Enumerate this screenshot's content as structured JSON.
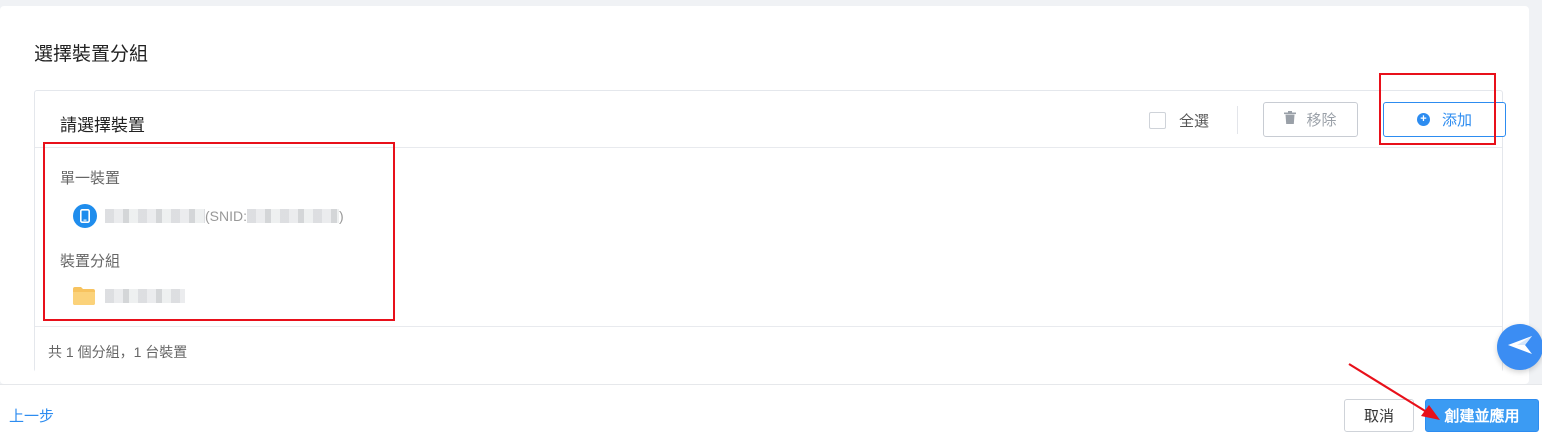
{
  "page": {
    "section_title": "選擇裝置分組"
  },
  "panel": {
    "title": "請選擇裝置",
    "select_all_label": "全選",
    "remove_label": "移除",
    "add_label": "添加",
    "groups": {
      "single_device_label": "單一裝置",
      "device_group_label": "裝置分組"
    },
    "device": {
      "snid_prefix": "(SNID:",
      "snid_suffix": ")"
    },
    "footer_summary": "共 1 個分組，1 台裝置"
  },
  "bottom_bar": {
    "prev_label": "上一步",
    "cancel_label": "取消",
    "create_label": "創建並應用"
  },
  "colors": {
    "primary": "#2d8cf0",
    "highlight_red": "#e8101a",
    "folder_yellow": "#f7c35f"
  }
}
